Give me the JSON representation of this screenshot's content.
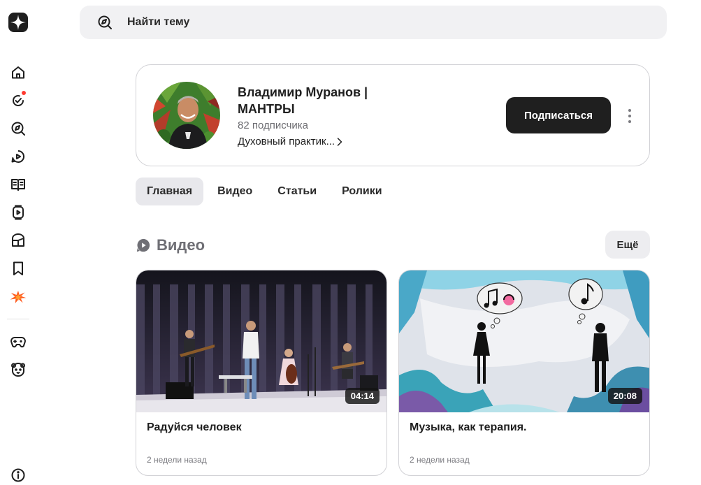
{
  "search": {
    "placeholder": "Найти тему"
  },
  "channel": {
    "name": "Владимир Муранов | МАНТРЫ",
    "subscribers": "82 подписчика",
    "description": "Духовный практик...",
    "subscribe_label": "Подписаться"
  },
  "tabs": [
    {
      "label": "Главная",
      "active": true
    },
    {
      "label": "Видео",
      "active": false
    },
    {
      "label": "Статьи",
      "active": false
    },
    {
      "label": "Ролики",
      "active": false
    }
  ],
  "section": {
    "title": "Видео",
    "more_label": "Ещё"
  },
  "videos": [
    {
      "title": "Радуйся человек",
      "duration": "04:14",
      "age": "2 недели назад"
    },
    {
      "title": "Музыка, как терапия.",
      "duration": "20:08",
      "age": "2 недели назад"
    }
  ],
  "rail": {
    "items": [
      "home-icon",
      "subscriptions-icon",
      "explore-icon",
      "video-icon",
      "articles-icon",
      "shorts-icon",
      "cube-icon",
      "bookmark-icon",
      "flash-icon",
      "gamepad-icon",
      "bear-icon",
      "info-icon"
    ]
  },
  "colors": {
    "accent": "#1f1f1f",
    "notification": "#ff3b30",
    "flash": "#ff5a1f"
  }
}
